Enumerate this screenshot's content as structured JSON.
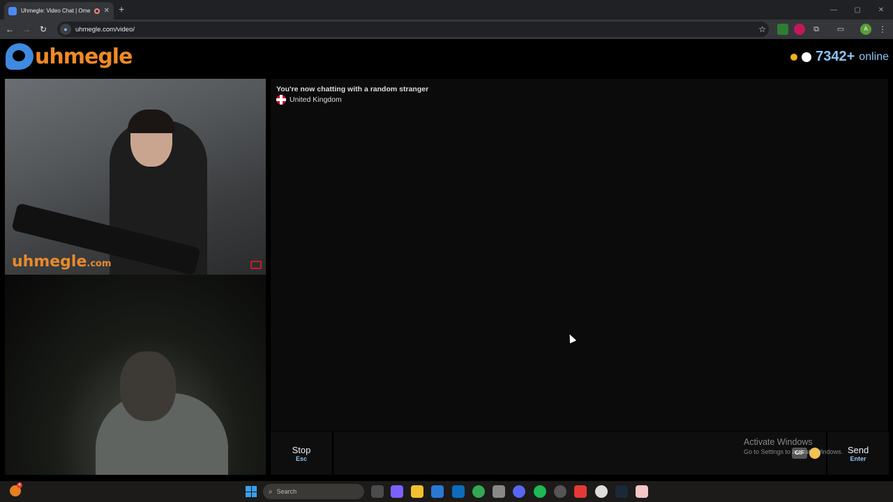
{
  "browser": {
    "tab_title": "Uhmegle: Video Chat | Ome",
    "tab_close": "✕",
    "new_tab": "+",
    "url": "uhmegle.com/video/",
    "window_controls": [
      "—",
      "▢",
      "✕"
    ]
  },
  "site": {
    "logo_text": "uhmegle",
    "online_count": "7342+",
    "online_label": "online"
  },
  "video": {
    "watermark_main": "uhmegle",
    "watermark_suffix": ".com"
  },
  "chat": {
    "status": "You're now chatting with a random stranger",
    "country": "United Kingdom"
  },
  "controls": {
    "stop_label": "Stop",
    "stop_key": "Esc",
    "send_label": "Send",
    "send_key": "Enter",
    "gif_label": "GIF"
  },
  "windows_notice": {
    "title": "Activate Windows",
    "subtitle": "Go to Settings to activate Windows."
  },
  "taskbar": {
    "search_placeholder": "Search",
    "badge_count": "4"
  },
  "colors": {
    "brand_orange": "#f08a24",
    "brand_blue": "#3f8ae0",
    "accent_blue": "#8ec5f5"
  }
}
